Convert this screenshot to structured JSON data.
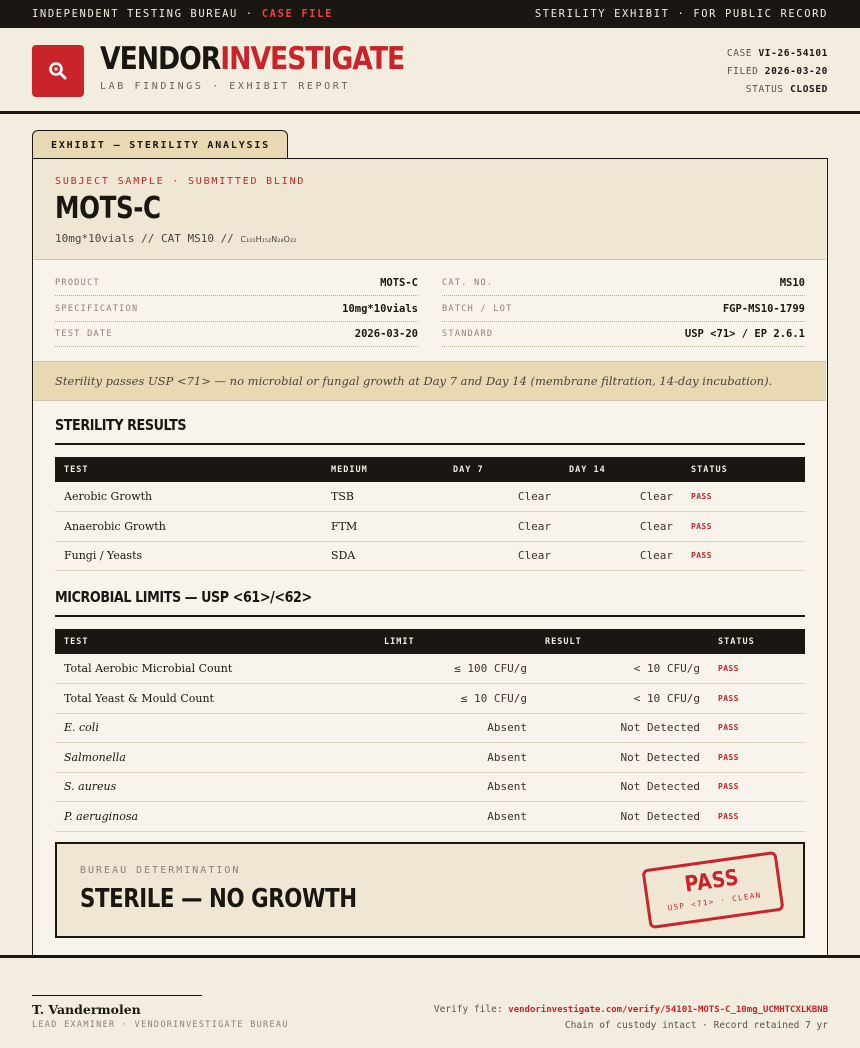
{
  "topbar": {
    "left": "INDEPENDENT TESTING BUREAU ·",
    "left_red": "CASE FILE",
    "right": "STERILITY EXHIBIT · FOR PUBLIC RECORD"
  },
  "header": {
    "brand_1": "VENDOR",
    "brand_2": "INVESTIGATE",
    "subtitle": "LAB FINDINGS · EXHIBIT REPORT",
    "case_label": "CASE",
    "case_value": "VI-26-54101",
    "filed_label": "FILED",
    "filed_value": "2026-03-20",
    "status_label": "STATUS",
    "status_value": "CLOSED"
  },
  "tab": {
    "label": "EXHIBIT — STERILITY ANALYSIS"
  },
  "subject": {
    "kicker": "SUBJECT SAMPLE · SUBMITTED BLIND",
    "title": "MOTS-C",
    "meta": "10mg*10vials  //  CAT MS10  //",
    "formula": "C₁₀₁H₁₅₂N₂₈O₂₂"
  },
  "specs": {
    "product_label": "PRODUCT",
    "product_value": "MOTS-C",
    "spec_label": "SPECIFICATION",
    "spec_value": "10mg*10vials",
    "date_label": "TEST DATE",
    "date_value": "2026-03-20",
    "cat_label": "CAT. NO.",
    "cat_value": "MS10",
    "batch_label": "BATCH / LOT",
    "batch_value": "FGP-MS10-1799",
    "standard_label": "STANDARD",
    "standard_value": "USP <71> / EP 2.6.1"
  },
  "summary": "Sterility passes USP <71> — no microbial or fungal growth at Day 7 and Day 14 (membrane filtration, 14-day incubation).",
  "sterility": {
    "title": "STERILITY RESULTS",
    "headers": [
      "TEST",
      "MEDIUM",
      "DAY 7",
      "DAY 14",
      "STATUS"
    ],
    "rows": [
      [
        "Aerobic Growth",
        "TSB",
        "Clear",
        "Clear",
        "PASS"
      ],
      [
        "Anaerobic Growth",
        "FTM",
        "Clear",
        "Clear",
        "PASS"
      ],
      [
        "Fungi / Yeasts",
        "SDA",
        "Clear",
        "Clear",
        "PASS"
      ]
    ]
  },
  "microbial": {
    "title": "MICROBIAL LIMITS — USP <61>/<62>",
    "headers": [
      "TEST",
      "LIMIT",
      "RESULT",
      "STATUS"
    ],
    "rows": [
      [
        "Total Aerobic Microbial Count",
        "≤ 100 CFU/g",
        "< 10 CFU/g",
        "PASS"
      ],
      [
        "Total Yeast & Mould Count",
        "≤ 10 CFU/g",
        "< 10 CFU/g",
        "PASS"
      ],
      [
        "E. coli",
        "Absent",
        "Not Detected",
        "PASS"
      ],
      [
        "Salmonella",
        "Absent",
        "Not Detected",
        "PASS"
      ],
      [
        "S. aureus",
        "Absent",
        "Not Detected",
        "PASS"
      ],
      [
        "P. aeruginosa",
        "Absent",
        "Not Detected",
        "PASS"
      ]
    ]
  },
  "determination": {
    "label": "BUREAU DETERMINATION",
    "value": "STERILE — NO GROWTH",
    "stamp_main": "PASS",
    "stamp_sub": "USP <71> · CLEAN"
  },
  "footer": {
    "name": "T. Vandermolen",
    "role": "LEAD EXAMINER · VENDORINVESTIGATE BUREAU",
    "verify_label": "Verify file:",
    "verify_url": "vendorinvestigate.com/verify/54101-MOTS-C_10mg_UCMHTCXLKBNB",
    "custody": "Chain of custody intact · Record retained 7 yr"
  },
  "colors": {
    "accent": "#c8242a",
    "ink": "#1a1612",
    "paper": "#f3ede0",
    "tan": "#e8d9b2"
  },
  "icons": {
    "logo": "magnifier-icon"
  }
}
